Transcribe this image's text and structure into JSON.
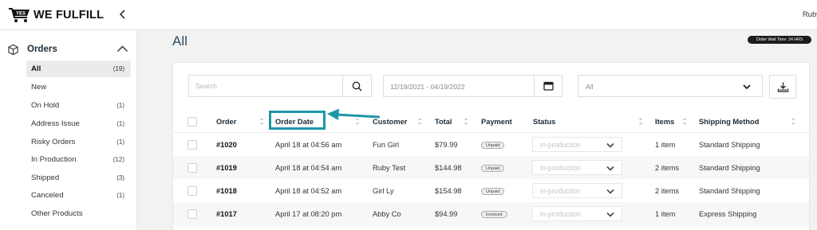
{
  "header": {
    "logo_badge": "YES",
    "logo_text": "WE FULFILL",
    "user": "Ruby"
  },
  "sidebar": {
    "section": "Orders",
    "items": [
      {
        "label": "All",
        "count": "(19)"
      },
      {
        "label": "New",
        "count": ""
      },
      {
        "label": "On Hold",
        "count": "(1)"
      },
      {
        "label": "Address Issue",
        "count": "(1)"
      },
      {
        "label": "Risky Orders",
        "count": "(1)"
      },
      {
        "label": "In Production",
        "count": "(12)"
      },
      {
        "label": "Shipped",
        "count": "(3)"
      },
      {
        "label": "Canceled",
        "count": "(1)"
      },
      {
        "label": "Other Products",
        "count": ""
      }
    ]
  },
  "main": {
    "title": "All",
    "wait_badge": "Order Wait Time: 24 HRS",
    "search_placeholder": "Search",
    "date_range": "12/19/2021 - 04/19/2022",
    "filter_value": "All"
  },
  "table": {
    "columns": [
      "Order",
      "Order Date",
      "Customer",
      "Total",
      "Payment",
      "Status",
      "Items",
      "Shipping Method"
    ],
    "rows": [
      {
        "order": "#1020",
        "date": "April 18 at 04:56 am",
        "customer": "Fun Girl",
        "total": "$79.99",
        "payment": "Unpaid",
        "status": "in-production",
        "items": "1 item",
        "shipping": "Standard Shipping"
      },
      {
        "order": "#1019",
        "date": "April 18 at 04:54 am",
        "customer": "Ruby Test",
        "total": "$144.98",
        "payment": "Unpaid",
        "status": "in-production",
        "items": "2 items",
        "shipping": "Standard Shipping"
      },
      {
        "order": "#1018",
        "date": "April 18 at 04:52 am",
        "customer": "Girl Ly",
        "total": "$154.98",
        "payment": "Unpaid",
        "status": "in-production",
        "items": "2 items",
        "shipping": "Standard Shipping"
      },
      {
        "order": "#1017",
        "date": "April 17 at 08:20 pm",
        "customer": "Abby Co",
        "total": "$94.99",
        "payment": "Invoiced",
        "status": "in-production",
        "items": "1 item",
        "shipping": "Express Shipping"
      }
    ]
  },
  "annotation": {
    "color": "#1d97a7"
  }
}
